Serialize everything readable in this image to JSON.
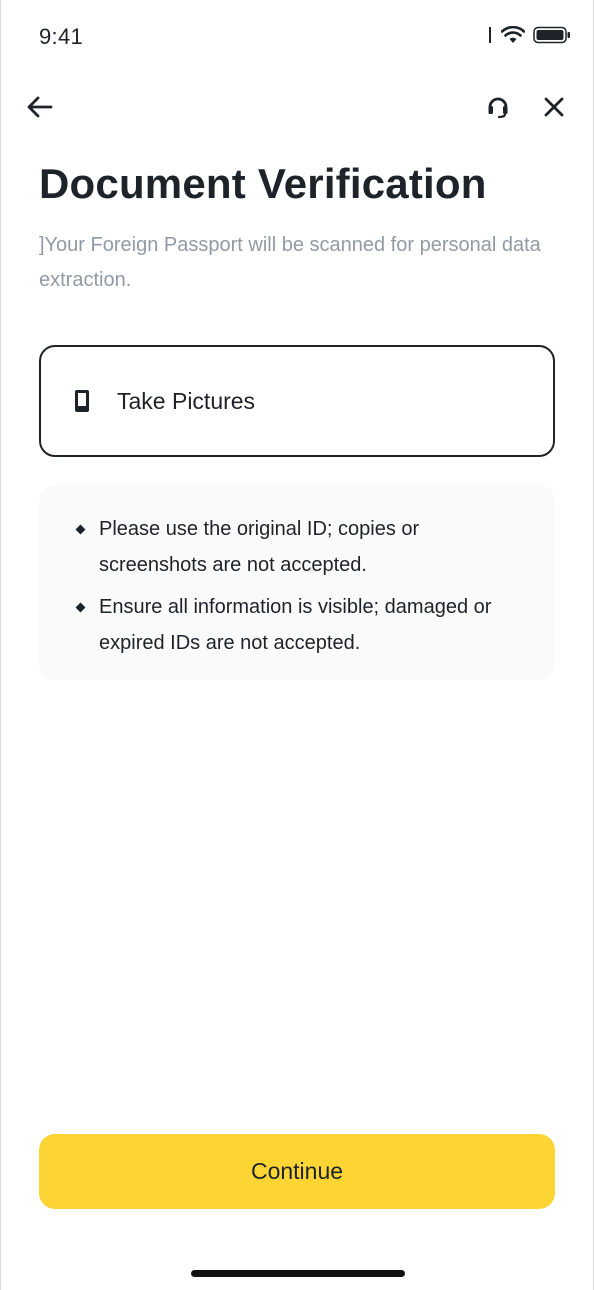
{
  "status_bar": {
    "time": "9:41"
  },
  "nav": {
    "back_icon": "arrow-left-icon",
    "support_icon": "headset-icon",
    "close_icon": "close-icon"
  },
  "header": {
    "title": "Document Verification",
    "subtitle": "]Your Foreign Passport will be scanned for personal data extraction."
  },
  "take_pictures": {
    "icon": "phone-icon",
    "label": "Take Pictures"
  },
  "requirements": [
    "Please use the original ID; copies or screenshots are not accepted.",
    "Ensure all information is visible; damaged or expired IDs are not accepted."
  ],
  "footer": {
    "continue_label": "Continue"
  },
  "colors": {
    "accent": "#fcd535",
    "text_primary": "#1e2329",
    "text_secondary": "#929aa5",
    "info_bg": "#fafafa"
  }
}
